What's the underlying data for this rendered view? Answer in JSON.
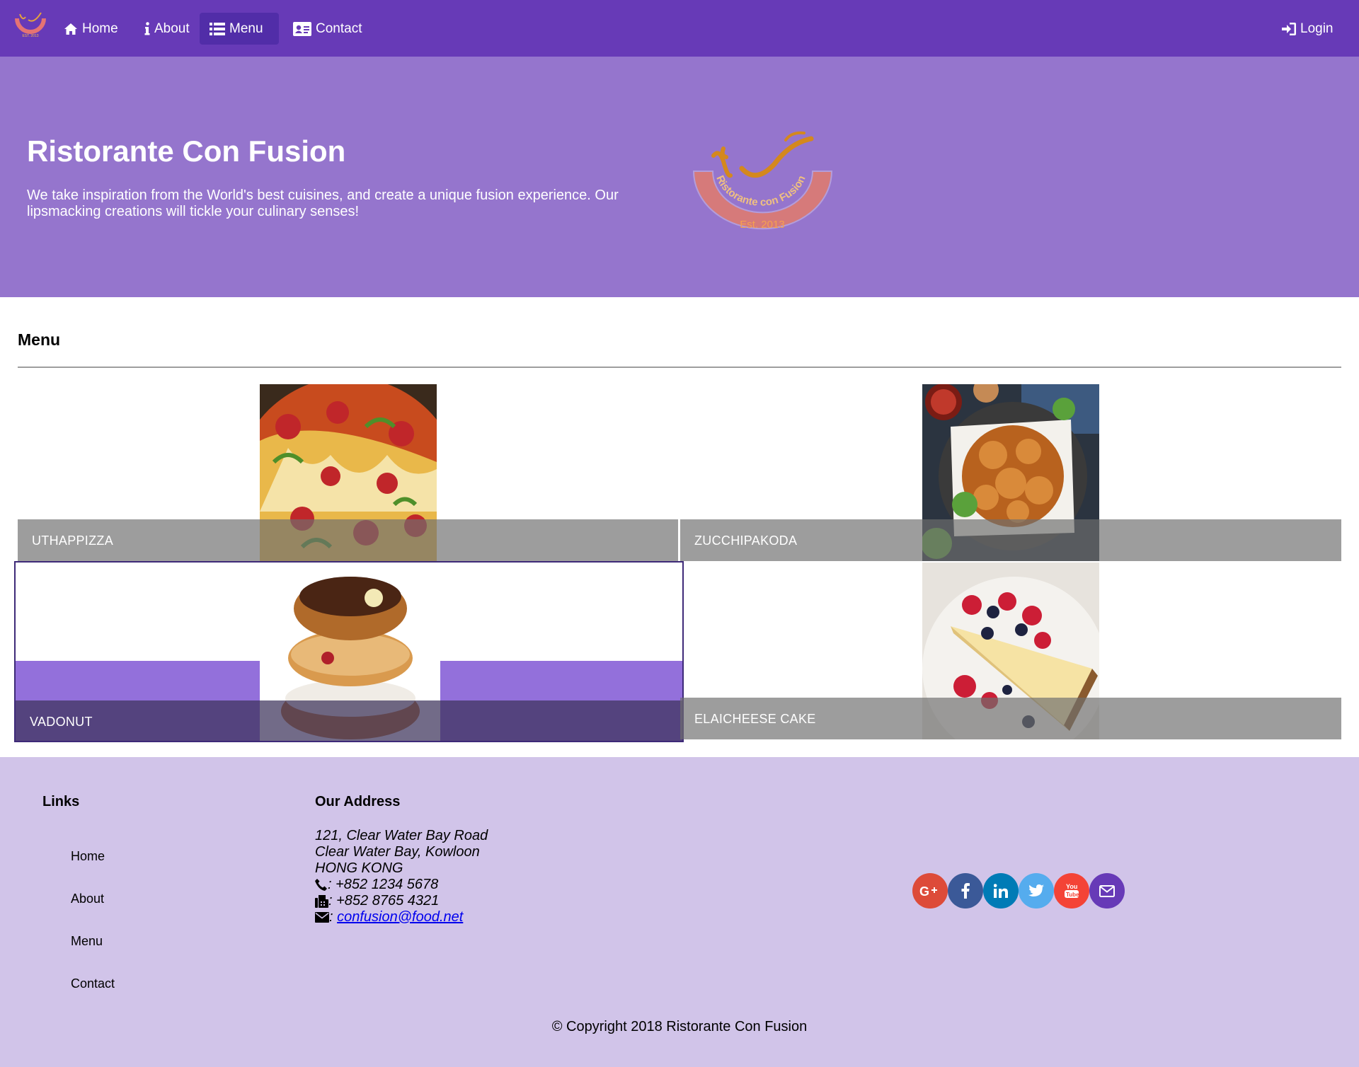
{
  "navbar": {
    "items": [
      {
        "label": "Home",
        "icon": "home-icon"
      },
      {
        "label": "About",
        "icon": "info-icon"
      },
      {
        "label": "Menu",
        "icon": "list-icon",
        "active": true
      },
      {
        "label": "Contact",
        "icon": "address-card-icon"
      }
    ],
    "login_label": "Login"
  },
  "jumbotron": {
    "title": "Ristorante Con Fusion",
    "text": "We take inspiration from the World's best cuisines, and create a unique fusion experience. Our lipsmacking creations will tickle your culinary senses!",
    "logo_text": "Ristorante con Fusion",
    "logo_year": "Est. 2013"
  },
  "menu": {
    "heading": "Menu",
    "dishes": [
      {
        "name": "UTHAPPIZZA"
      },
      {
        "name": "ZUCCHIPAKODA"
      },
      {
        "name": "VADONUT"
      },
      {
        "name": "ELAICHEESE CAKE"
      }
    ]
  },
  "footer": {
    "links_heading": "Links",
    "links": [
      "Home",
      "About",
      "Menu",
      "Contact"
    ],
    "address_heading": "Our Address",
    "address_lines": [
      "121, Clear Water Bay Road",
      "Clear Water Bay, Kowloon",
      "HONG KONG"
    ],
    "phone": ": +852 1234 5678",
    "fax": ": +852 8765 4321",
    "email_prefix": ": ",
    "email": "confusion@food.net",
    "social": [
      {
        "icon": "google-plus-icon",
        "color": "#dd4b39"
      },
      {
        "icon": "facebook-icon",
        "color": "#3b5998"
      },
      {
        "icon": "linkedin-icon",
        "color": "#007bb6"
      },
      {
        "icon": "twitter-icon",
        "color": "#55acee"
      },
      {
        "icon": "youtube-icon",
        "color": "#f44336"
      },
      {
        "icon": "mail-icon",
        "color": "#673ab7"
      }
    ],
    "copyright": "© Copyright 2018 Ristorante Con Fusion"
  },
  "colors": {
    "primary": "#673ab7",
    "primary_dark": "#512da8",
    "jumbotron": "#9575cd",
    "footer": "#d1c4e9"
  }
}
